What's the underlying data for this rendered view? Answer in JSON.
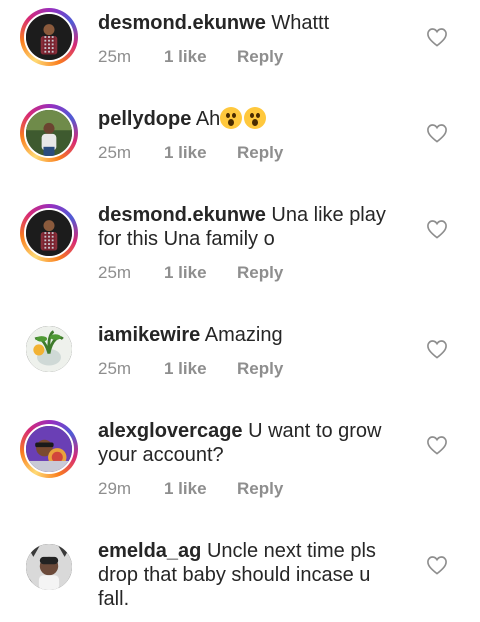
{
  "comments": [
    {
      "username": "desmond.ekunwe",
      "text": "Whattt",
      "time": "25m",
      "likes": "1 like",
      "reply": "Reply"
    },
    {
      "username": "pellydope",
      "text": "Ah",
      "time": "25m",
      "likes": "1 like",
      "reply": "Reply"
    },
    {
      "username": "desmond.ekunwe",
      "text": "Una like play for this Una family o",
      "time": "25m",
      "likes": "1 like",
      "reply": "Reply"
    },
    {
      "username": "iamikewire",
      "text": "Amazing",
      "time": "25m",
      "likes": "1 like",
      "reply": "Reply"
    },
    {
      "username": "alexglovercage",
      "text": "U want to grow your account?",
      "time": "29m",
      "likes": "1 like",
      "reply": "Reply"
    },
    {
      "username": "emelda_ag",
      "text": "Uncle next time pls drop that baby should incase u fall."
    }
  ],
  "emoji": "😮😮",
  "icons": {
    "like": "heart-outline-icon"
  },
  "colors": {
    "text": "#262626",
    "meta": "#8e8e8e",
    "heart_stroke": "#8e8e8e"
  }
}
